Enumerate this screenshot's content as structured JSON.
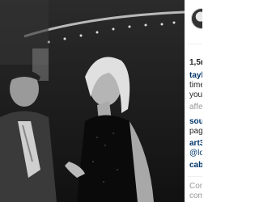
{
  "post": {
    "likes_text": "1,5r",
    "comments": [
      {
        "user": "tayl",
        "lines": [
          "time",
          "you"
        ]
      },
      {
        "user": "",
        "lines": [
          "affe"
        ]
      },
      {
        "user": "sou",
        "lines": [
          "pag"
        ]
      },
      {
        "user": "art3",
        "lines": [
          "@lo"
        ]
      },
      {
        "user": "cab",
        "lines": []
      }
    ],
    "add_comment_lines": [
      "Con",
      "com"
    ]
  }
}
